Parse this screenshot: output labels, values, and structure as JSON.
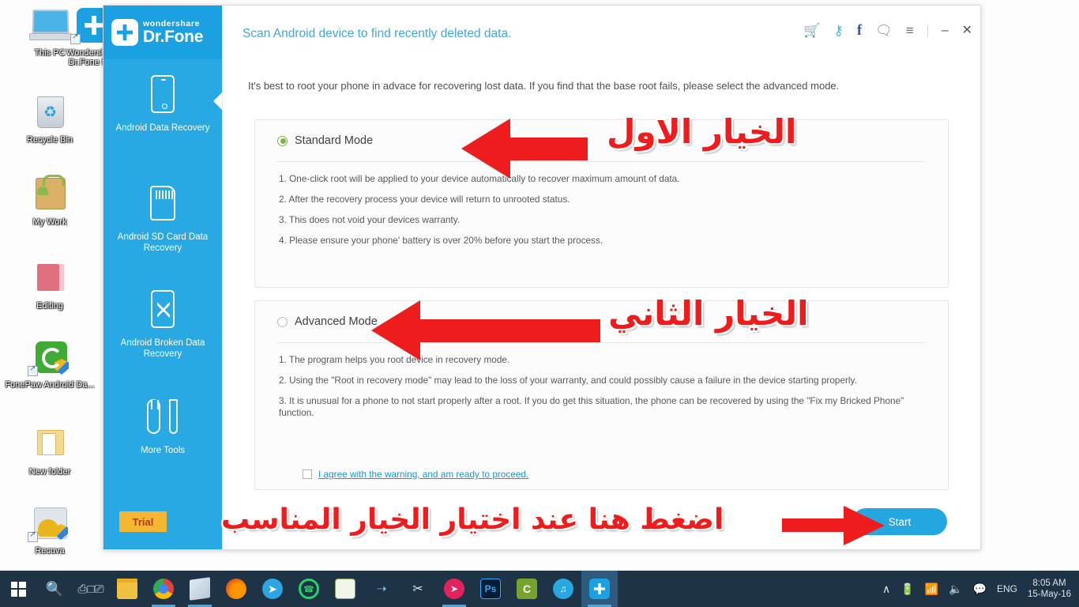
{
  "desktop": {
    "icons": [
      {
        "label": "This PC",
        "icon": "this-pc-icon"
      },
      {
        "label": "Wondershare Dr.Fone fo...",
        "icon": "drfone-shortcut-icon"
      },
      {
        "label": "Recycle Bin",
        "icon": "recycle-bin-icon"
      },
      {
        "label": "My Work",
        "icon": "android-bag-folder-icon"
      },
      {
        "label": "Editing",
        "icon": "pink-folder-icon"
      },
      {
        "label": "FonePaw Android Da...",
        "icon": "fonepaw-icon"
      },
      {
        "label": "New folder",
        "icon": "yellow-folder-icon"
      },
      {
        "label": "Recuva",
        "icon": "recuva-icon"
      }
    ]
  },
  "app": {
    "brand": {
      "top": "wondershare",
      "name": "Dr.Fone"
    },
    "title": "Scan Android device to find recently deleted data.",
    "title_icons": [
      {
        "name": "cart-icon",
        "glyph": "🛒",
        "color": "#f0a818"
      },
      {
        "name": "key-icon",
        "glyph": "⚷",
        "color": "#36b7e8"
      },
      {
        "name": "facebook-icon",
        "glyph": "f",
        "color": "#3b5998"
      },
      {
        "name": "chat-icon",
        "glyph": "□",
        "color": "#6a7176"
      },
      {
        "name": "menu-icon",
        "glyph": "≡",
        "color": "#6a7176"
      },
      {
        "name": "minimize-icon",
        "glyph": "–",
        "color": "#555555"
      },
      {
        "name": "close-icon",
        "glyph": "✕",
        "color": "#555555"
      }
    ],
    "sidebar": {
      "items": [
        {
          "label": "Android Data Recovery",
          "icon": "phone-icon",
          "active": true
        },
        {
          "label": "Android SD Card Data Recovery",
          "icon": "sd-card-icon",
          "active": false
        },
        {
          "label": "Android Broken Data Recovery",
          "icon": "broken-phone-icon",
          "active": false
        },
        {
          "label": "More Tools",
          "icon": "tools-icon",
          "active": false
        }
      ],
      "trial_label": "Trial"
    },
    "content": {
      "intro": "It's best to root your phone in advace for recovering lost data. If you find that the base root fails, please select the advanced mode.",
      "standard": {
        "label": "Standard Mode",
        "selected": true,
        "bullets": [
          "1. One-click root will be applied to your device automatically to recover maximum amount of data.",
          "2. After the recovery process your device will return to unrooted status.",
          "3. This does not void your devices warranty.",
          "4. Please ensure your phone' battery is over 20% before you start the process."
        ]
      },
      "advanced": {
        "label": "Advanced Mode",
        "selected": false,
        "bullets": [
          "1. The program  helps you root device in recovery mode.",
          "2. Using the \"Root in recovery mode\" may lead to the loss of your warranty, and could possibly cause a failure in the device starting properly.",
          "3. It is unusual for a phone to not start properly after a root. If you do get this situation, the phone can be recovered by using the \"Fix my Bricked Phone\" function."
        ],
        "agree_label": "I agree with the warning, and am ready to proceed.",
        "agree_checked": false
      },
      "start_label": "Start"
    }
  },
  "annotations": {
    "color": "#ee1c1c",
    "first_option": "الخيار الاول",
    "second_option": "الخيار الثاني",
    "press_here": "اضغط هنا عند اختيار الخيار المناسب"
  },
  "taskbar": {
    "buttons": [
      {
        "name": "start-button",
        "icon": "windows-logo-icon"
      },
      {
        "name": "search-button",
        "icon": "search-icon"
      },
      {
        "name": "task-view-button",
        "icon": "task-view-icon"
      },
      {
        "name": "file-explorer-button",
        "icon": "folder-icon"
      },
      {
        "name": "chrome-button",
        "icon": "chrome-icon"
      },
      {
        "name": "store-button",
        "icon": "store-icon"
      },
      {
        "name": "firefox-button",
        "icon": "firefox-icon"
      },
      {
        "name": "telegram-button",
        "icon": "telegram-icon"
      },
      {
        "name": "whatsapp-button",
        "icon": "whatsapp-icon"
      },
      {
        "name": "notepad-button",
        "icon": "notepad-icon"
      },
      {
        "name": "idm-button",
        "icon": "idm-icon"
      },
      {
        "name": "snipping-tool-button",
        "icon": "scissors-icon"
      },
      {
        "name": "recorder-button",
        "icon": "recorder-icon"
      },
      {
        "name": "photoshop-button",
        "icon": "photoshop-icon",
        "label": "Ps"
      },
      {
        "name": "camtasia-button",
        "icon": "camtasia-icon"
      },
      {
        "name": "wondershare-filmora-button",
        "icon": "filmora-icon"
      },
      {
        "name": "drfone-button",
        "icon": "drfone-icon"
      }
    ],
    "tray": {
      "chevron": "∧",
      "battery": "battery-icon",
      "wifi": "wifi-icon",
      "volume": "volume-icon",
      "action_center": "action-center-icon",
      "language": "ENG",
      "time": "8:05 AM",
      "date": "15-May-16"
    }
  }
}
